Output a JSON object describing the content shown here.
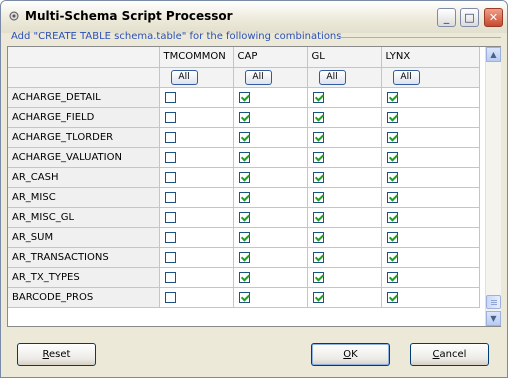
{
  "window": {
    "title": "Multi-Schema Script Processor"
  },
  "group": {
    "label": "Add \"CREATE TABLE schema.table\" for the following combinations"
  },
  "columns": [
    "",
    "TMCOMMON",
    "CAP",
    "GL",
    "LYNX"
  ],
  "all_label": "All",
  "rows": [
    {
      "name": "ACHARGE_DETAIL",
      "checks": [
        false,
        true,
        true,
        true
      ]
    },
    {
      "name": "ACHARGE_FIELD",
      "checks": [
        false,
        true,
        true,
        true
      ]
    },
    {
      "name": "ACHARGE_TLORDER",
      "checks": [
        false,
        true,
        true,
        true
      ]
    },
    {
      "name": "ACHARGE_VALUATION",
      "checks": [
        false,
        true,
        true,
        true
      ]
    },
    {
      "name": "AR_CASH",
      "checks": [
        false,
        true,
        true,
        true
      ]
    },
    {
      "name": "AR_MISC",
      "checks": [
        false,
        true,
        true,
        true
      ]
    },
    {
      "name": "AR_MISC_GL",
      "checks": [
        false,
        true,
        true,
        true
      ]
    },
    {
      "name": "AR_SUM",
      "checks": [
        false,
        true,
        true,
        true
      ]
    },
    {
      "name": "AR_TRANSACTIONS",
      "checks": [
        false,
        true,
        true,
        true
      ]
    },
    {
      "name": "AR_TX_TYPES",
      "checks": [
        false,
        true,
        true,
        true
      ]
    },
    {
      "name": "BARCODE_PROS",
      "checks": [
        false,
        true,
        true,
        true
      ]
    }
  ],
  "buttons": {
    "reset": "Reset",
    "ok": "OK",
    "cancel": "Cancel"
  },
  "icons": {
    "title": "gear-icon",
    "minimize": "minimize-icon",
    "maximize": "maximize-icon",
    "close": "close-icon"
  }
}
